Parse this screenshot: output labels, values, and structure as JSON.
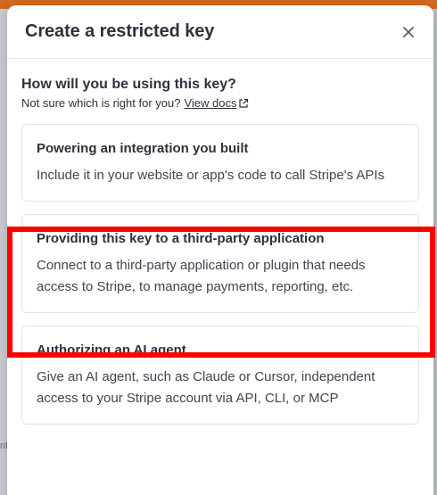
{
  "modal": {
    "title": "Create a restricted key",
    "close_label": "×"
  },
  "intro": {
    "question": "How will you be using this key?",
    "hint_text": "Not sure which is right for you?",
    "docs_link": "View docs"
  },
  "options": [
    {
      "title": "Powering an integration you built",
      "description": "Include it in your website or app's code to call Stripe's APIs"
    },
    {
      "title": "Providing this key to a third-party application",
      "description": "Connect to a third-party application or plugin that needs access to Stripe, to manage payments, reporting, etc."
    },
    {
      "title": "Authorizing an AI agent",
      "description": "Give an AI agent, such as Claude or Cursor, independent access to your Stripe account via API, CLI, or MCP"
    }
  ],
  "background": {
    "left_fragment": "nt"
  },
  "colors": {
    "highlight": "#ff0000",
    "top_accent": "#d2691e"
  }
}
